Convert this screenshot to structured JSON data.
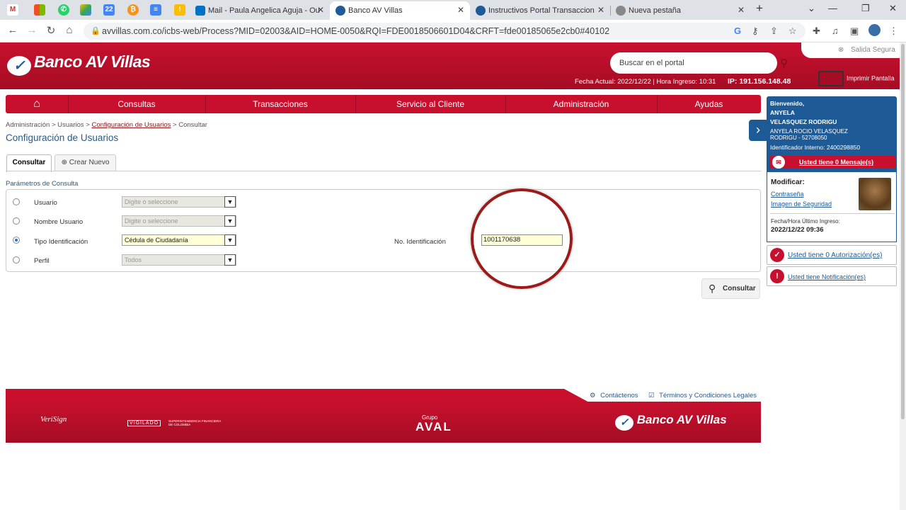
{
  "browser": {
    "tabs": [
      {
        "title": "Mail - Paula Angelica Aguja - Ou"
      },
      {
        "title": "Banco AV Villas"
      },
      {
        "title": "Instructivos Portal Transaccional"
      },
      {
        "title": "Nueva pestaña"
      }
    ],
    "url": "avvillas.com.co/icbs-web/Process?MID=02003&AID=HOME-0050&RQI=FDE0018506601D04&CRFT=fde00185065e2cb0#40102"
  },
  "header": {
    "logo": "Banco AV Villas",
    "salida": "Salida Segura",
    "search_placeholder": "Buscar en el portal",
    "fecha": "Fecha Actual: 2022/12/22 | Hora Ingreso: 10:31",
    "ip": "IP: 191.156.148.48",
    "imprimir": "Imprimir Pantalla"
  },
  "nav": [
    "Consultas",
    "Transacciones",
    "Servicio al Cliente",
    "Administración",
    "Ayudas"
  ],
  "breadcrumb": {
    "a": "Administración",
    "b": "Usuarios",
    "c": "Configuración de Usuarios",
    "d": "Consultar"
  },
  "page_title": "Configuración de Usuarios",
  "tabs": {
    "consultar": "Consultar",
    "crear": "Crear Nuevo"
  },
  "params": {
    "label": "Parámetros de Consulta",
    "usuario_label": "Usuario",
    "usuario_value": "Digite o seleccione",
    "nombre_label": "Nombre Usuario",
    "nombre_value": "Digite o seleccione",
    "tipo_label": "Tipo Identificación",
    "tipo_value": "Cédula de Ciudadanía",
    "perfil_label": "Perfil",
    "perfil_value": "Todos",
    "noid_label": "No. Identificación",
    "noid_value": "1001170638"
  },
  "consultar_button": "Consultar",
  "sidebar": {
    "bienvenido": "Bienvenido,",
    "name1": "ANYELA",
    "name2": "VELASQUEZ RODRIGU",
    "fullname1": "ANYELA ROCIO VELASQUEZ",
    "fullname2": "RODRIGU - 52708050",
    "identificador": "Identificador Interno: 2400298850",
    "mensajes": "Usted tiene 0 Mensaje(s)",
    "modificar": "Modificar:",
    "contrasena": "Contraseña",
    "imagen": "Imagen de Seguridad",
    "fecha_label": "Fecha/Hora Último Ingreso:",
    "fecha_value": "2022/12/22 09:36",
    "autorizaciones": "Usted tiene 0 Autorización(es)",
    "notificaciones": "Usted tiene Notificación(es)"
  },
  "footer": {
    "contactenos": "Contáctenos",
    "terminos": "Términos y Condiciones Legales",
    "verisign": "VeriSign",
    "vigilado": "VIGILADO",
    "superfinanciera": "SUPERINTENDENCIA FINANCIERA DE COLOMBIA",
    "grupo": "Grupo",
    "aval": "AVAL",
    "logo": "Banco AV Villas"
  },
  "colors": {
    "brand_red": "#c8102e",
    "brand_blue": "#1d5a96"
  }
}
